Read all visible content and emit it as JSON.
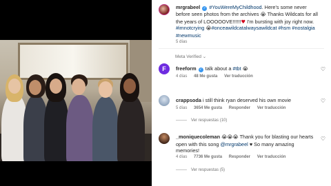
{
  "post": {
    "author": "mrgrabeel",
    "caption": {
      "hashtag1": "#YouWereMyChildhood",
      "text1": ". Here's some never before seen photos from the archives",
      "text2": " Thanks Wildcats for all the years of LOOOOOVE!!!!!!",
      "text3": " I'm bursting with joy right now.",
      "tags": [
        "#imnotcrying",
        "#onceawildcatalwaysawildcat",
        "#hsm",
        "#nostalgia",
        "#newmusic"
      ]
    },
    "time": "5 días",
    "edited_label": "Meta Verified",
    "edited_chevron": "⌄"
  },
  "comments": [
    {
      "username": "freeform",
      "text": "talk about a",
      "tag": "#tbt",
      "emoji": "😭",
      "time": "4 días",
      "likes": "48 Me gusta",
      "reply": "Ver traducción",
      "avatar_color": "#6e2ce0",
      "avatar_letter": "F"
    },
    {
      "username": "crappsoda",
      "text": "i still think ryan deserved his own movie",
      "time": "5 días",
      "likes": "3654 Me gusta",
      "reply": "Responder",
      "translate": "Ver traducción",
      "replies": "Ver respuestas (10)",
      "avatar_color": "#aebfd3"
    },
    {
      "username": "_moniquecoleman",
      "emoji": "😭😭😭",
      "text": "Thank you for blasting our hearts open with this song",
      "mention": "@mrgrabeel",
      "text2": "♥ So many amazing memories!",
      "time": "4 días",
      "likes": "7736 Me gusta",
      "reply": "Responder",
      "translate": "Ver traducción",
      "replies": "Ver respuestas (5)",
      "avatar_color": "#5a3a2a"
    }
  ],
  "icons": {
    "verified": "✓",
    "like": "♡"
  }
}
